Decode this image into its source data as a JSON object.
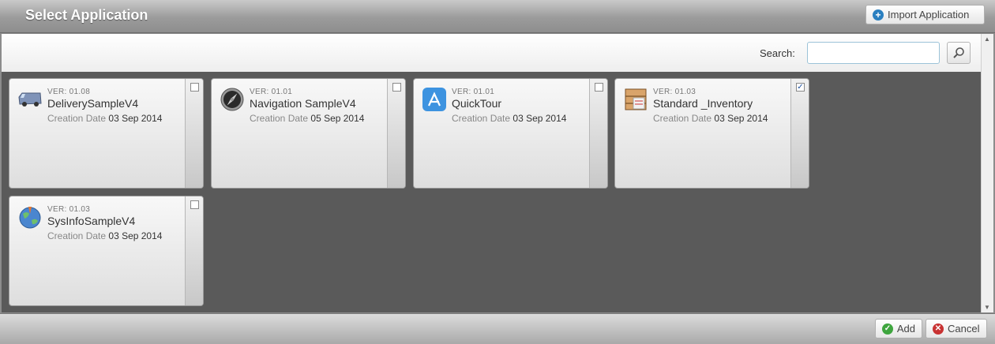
{
  "window": {
    "title": "Select Application"
  },
  "toolbar": {
    "import_label": "Import Application",
    "import_icon": "plus-circle-icon"
  },
  "search": {
    "label": "Search:",
    "value": "",
    "placeholder": "",
    "button_icon": "search-icon"
  },
  "cards": [
    {
      "ver": "VER: 01.08",
      "name": "DeliverySampleV4",
      "date_label": "Creation Date",
      "date": "03 Sep 2014",
      "checked": false,
      "icon": "delivery-van-icon"
    },
    {
      "ver": "VER: 01.01",
      "name": "Navigation SampleV4",
      "date_label": "Creation Date",
      "date": "05 Sep 2014",
      "checked": false,
      "icon": "compass-icon"
    },
    {
      "ver": "VER: 01.01",
      "name": "QuickTour",
      "date_label": "Creation Date",
      "date": "03 Sep 2014",
      "checked": false,
      "icon": "app-store-icon"
    },
    {
      "ver": "VER: 01.03",
      "name": "Standard _Inventory",
      "date_label": "Creation Date",
      "date": "03 Sep 2014",
      "checked": true,
      "icon": "inventory-boxes-icon"
    },
    {
      "ver": "VER: 01.03",
      "name": "SysInfoSampleV4",
      "date_label": "Creation Date",
      "date": "03 Sep 2014",
      "checked": false,
      "icon": "globe-info-icon"
    }
  ],
  "footer": {
    "add_label": "Add",
    "cancel_label": "Cancel"
  },
  "colors": {
    "content_bg": "#5a5a5a",
    "accent": "#2a7fc0",
    "add": "#3ea53e",
    "cancel": "#c83232"
  }
}
